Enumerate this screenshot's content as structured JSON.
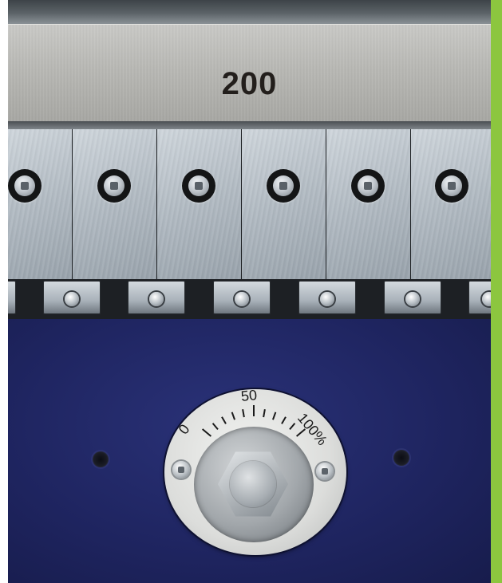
{
  "rail": {
    "label": "200"
  },
  "dial": {
    "scale_min": "0",
    "scale_mid": "50",
    "scale_max": "100%",
    "tick_count": 11
  },
  "colors": {
    "panel_navy": "#1f2561",
    "accent_green": "#8cc63f",
    "rail_aluminium": "#b8b8b4",
    "label_text": "#231f1c"
  }
}
